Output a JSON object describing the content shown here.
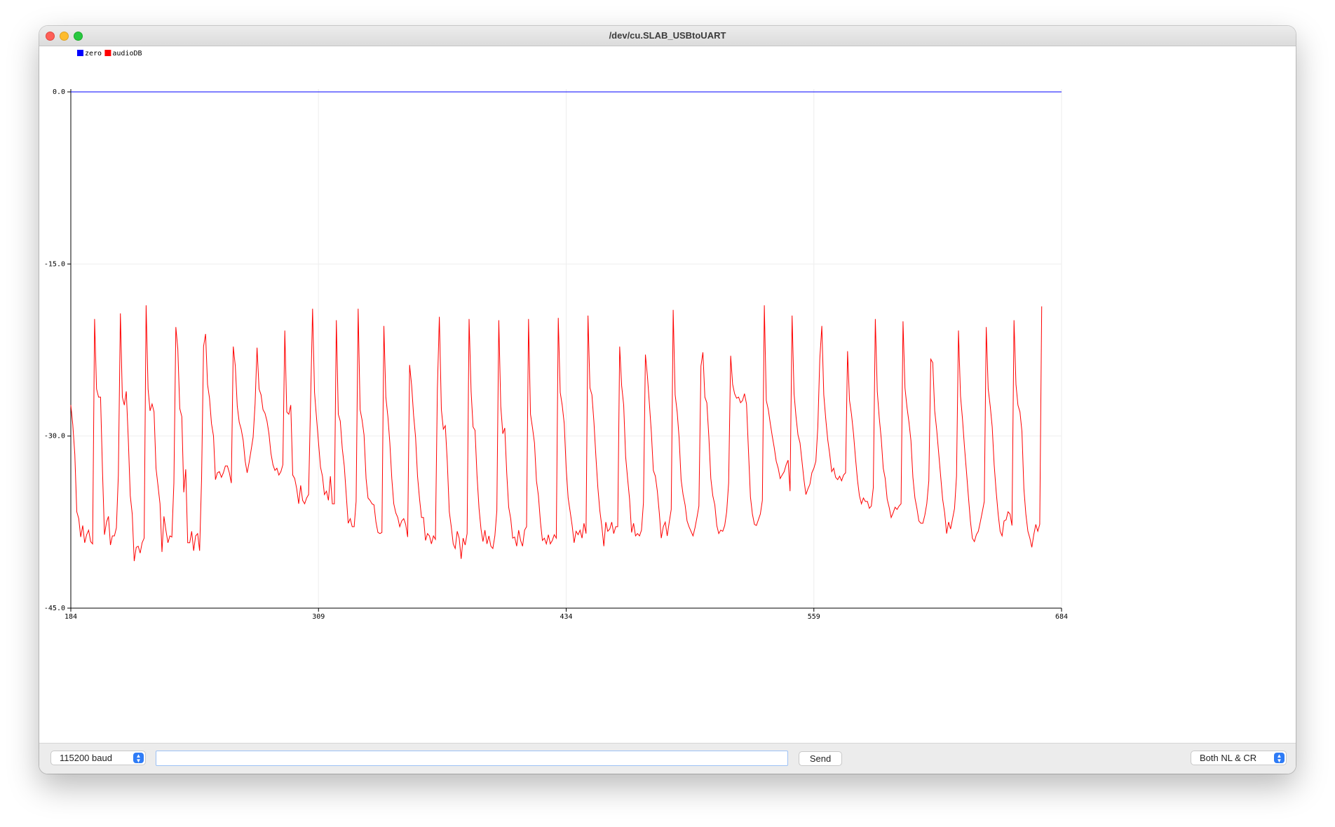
{
  "window": {
    "title": "/dev/cu.SLAB_USBtoUART"
  },
  "toolbar": {
    "baud_label": "115200 baud",
    "message_value": "",
    "send_label": "Send",
    "line_ending_label": "Both NL & CR"
  },
  "icons": {
    "stepper": "up-down-arrows-icon"
  },
  "colors": {
    "zero": "#0000ff",
    "audioDB": "#ff0000",
    "grid": "#eeeeee",
    "axis": "#000000"
  },
  "chart_data": {
    "type": "line",
    "xlim": [
      184,
      684
    ],
    "ylim": [
      -45,
      0
    ],
    "x_ticks": [
      184,
      309,
      434,
      559,
      684
    ],
    "y_ticks": [
      0,
      -15,
      -30,
      -45
    ],
    "x_tick_labels": [
      "184",
      "309",
      "434",
      "559",
      "684"
    ],
    "y_tick_labels": [
      "0.0",
      "-15.0",
      "-30.0",
      "-45.0"
    ],
    "grid": true,
    "legend_position": "top-left",
    "series": [
      {
        "name": "zero",
        "color": "#0000ff",
        "x_start": 184,
        "x_step": 1,
        "values": [
          0,
          0
        ]
      },
      {
        "name": "audioDB",
        "color": "#ff0000",
        "x_start": 184,
        "x_step": 1,
        "values": [
          -27.3,
          -29,
          -31.6,
          -36.6,
          -37.2,
          -38.8,
          -37.8,
          -39.3,
          -38.6,
          -38.2,
          -39.2,
          -39.4,
          -19.8,
          -25.9,
          -26.6,
          -26.6,
          -33.1,
          -38.6,
          -37.5,
          -37,
          -39.5,
          -38.7,
          -38.7,
          -38,
          -33.4,
          -19.3,
          -26.6,
          -27.3,
          -26.1,
          -30.3,
          -35.2,
          -36.8,
          -40.9,
          -39.7,
          -39.6,
          -40.2,
          -39.3,
          -38.9,
          -18.6,
          -25.9,
          -27.8,
          -27.2,
          -27.9,
          -32.8,
          -34.3,
          -35.9,
          -40.1,
          -37,
          -38.2,
          -39.3,
          -38.7,
          -38.8,
          -34.1,
          -20.5,
          -22.4,
          -27.6,
          -28.3,
          -34.9,
          -32.9,
          -39.3,
          -39.3,
          -38.3,
          -40,
          -38.7,
          -38.5,
          -40,
          -33.7,
          -22.2,
          -21.1,
          -25.5,
          -26.7,
          -28.9,
          -30,
          -33.8,
          -33.2,
          -33.1,
          -33.6,
          -33.2,
          -32.6,
          -32.6,
          -33.2,
          -34.1,
          -22.2,
          -23.9,
          -27.4,
          -28.8,
          -29.4,
          -30.4,
          -32.2,
          -33.2,
          -32.3,
          -31.2,
          -30.1,
          -27.2,
          -22.3,
          -25.9,
          -26.4,
          -27.7,
          -28,
          -28.7,
          -29.8,
          -31.5,
          -32.5,
          -33,
          -32.8,
          -33.4,
          -33.1,
          -32.5,
          -20.8,
          -27.9,
          -28.1,
          -27.3,
          -33.4,
          -33.7,
          -34.6,
          -35.9,
          -34.3,
          -35.6,
          -35.9,
          -35.4,
          -35.1,
          -27.2,
          -18.9,
          -26.2,
          -28.4,
          -30.6,
          -32.7,
          -33.5,
          -35.1,
          -34.8,
          -35.6,
          -33.5,
          -35.9,
          -35.9,
          -19.9,
          -28.1,
          -28.7,
          -31.1,
          -32.6,
          -35.1,
          -37.6,
          -37.2,
          -37.9,
          -37.9,
          -35.7,
          -18.9,
          -27.7,
          -28.6,
          -29.9,
          -33.7,
          -35.4,
          -35.6,
          -35.9,
          -36,
          -37.5,
          -38.4,
          -38.5,
          -38.4,
          -20.4,
          -26.6,
          -28.3,
          -30.6,
          -33.7,
          -35.9,
          -36.7,
          -37.1,
          -37.9,
          -37.4,
          -37.2,
          -37.7,
          -38.8,
          -23.8,
          -25.6,
          -28.2,
          -30.1,
          -33.5,
          -35.5,
          -37.1,
          -37.1,
          -39.1,
          -38.5,
          -38.7,
          -39.4,
          -38.7,
          -39,
          -25.9,
          -19.6,
          -27.7,
          -29.4,
          -29.1,
          -32.2,
          -36.6,
          -37.9,
          -39.4,
          -39.8,
          -38.3,
          -38.9,
          -40.7,
          -38.9,
          -39.5,
          -38.5,
          -19.8,
          -26.1,
          -29.2,
          -29.5,
          -33.4,
          -36.3,
          -38.1,
          -39.2,
          -38.2,
          -39.4,
          -38.7,
          -39.6,
          -39.8,
          -38.7,
          -36.5,
          -19.9,
          -27.4,
          -29.8,
          -29.3,
          -33.2,
          -36.2,
          -37.2,
          -38.9,
          -38.8,
          -39.6,
          -38.2,
          -39.1,
          -39.6,
          -38.2,
          -37.9,
          -19.8,
          -28.1,
          -29.3,
          -30.6,
          -33.9,
          -35.2,
          -37.5,
          -39.1,
          -38.9,
          -39.4,
          -38.6,
          -39.4,
          -39.1,
          -38.6,
          -38.9,
          -19.7,
          -26.2,
          -27.3,
          -28.9,
          -32.8,
          -35.4,
          -36.6,
          -37.8,
          -39.3,
          -38.3,
          -38.6,
          -38.2,
          -38.9,
          -37.6,
          -38.5,
          -19.5,
          -25.8,
          -26.4,
          -28.8,
          -31.8,
          -34.5,
          -36.5,
          -37.9,
          -39.6,
          -37.5,
          -38.3,
          -38.1,
          -37.5,
          -38.5,
          -37.9,
          -37.9,
          -22.2,
          -25.6,
          -27.3,
          -31.8,
          -33.7,
          -35.5,
          -38.4,
          -37.6,
          -38.7,
          -38.5,
          -38.7,
          -38.2,
          -35.8,
          -22.9,
          -24.8,
          -27.2,
          -29.7,
          -33,
          -33.5,
          -34.8,
          -36.7,
          -38.9,
          -37.9,
          -37.5,
          -38.7,
          -37.5,
          -36.4,
          -19,
          -26.4,
          -27.9,
          -30.2,
          -33.8,
          -35.1,
          -36,
          -37.4,
          -37.9,
          -38.3,
          -38.7,
          -38,
          -37.1,
          -36.1,
          -23.9,
          -22.7,
          -26.6,
          -27.1,
          -30.1,
          -33.7,
          -35.2,
          -36,
          -37.8,
          -38.5,
          -38.2,
          -38.3,
          -37.8,
          -36.6,
          -34.1,
          -23,
          -25.5,
          -26.3,
          -26.7,
          -26.6,
          -27.1,
          -26.9,
          -26.3,
          -27.2,
          -31.3,
          -35.3,
          -36.8,
          -37.7,
          -37.8,
          -37.3,
          -36.8,
          -35.6,
          -18.6,
          -26.9,
          -27.7,
          -28.9,
          -30,
          -31,
          -32.2,
          -32.8,
          -33.7,
          -33.4,
          -33.1,
          -32.5,
          -32.1,
          -34.8,
          -19.5,
          -26.3,
          -28.3,
          -29.9,
          -30.6,
          -32.2,
          -33.8,
          -35.1,
          -34.6,
          -34.2,
          -33.2,
          -32.8,
          -32.2,
          -29.2,
          -23.3,
          -20.4,
          -26.4,
          -28.5,
          -30.3,
          -31.6,
          -33.1,
          -32.8,
          -33.6,
          -33.8,
          -33.5,
          -33.9,
          -33.4,
          -33.2,
          -22.6,
          -26.9,
          -28.1,
          -29.8,
          -31.9,
          -33.8,
          -35.2,
          -35.9,
          -35.4,
          -35.7,
          -35.7,
          -36.3,
          -36.1,
          -34.5,
          -19.8,
          -26.1,
          -28.4,
          -30.2,
          -32.8,
          -33.7,
          -35.5,
          -36.2,
          -37.1,
          -36.7,
          -36.2,
          -36.4,
          -36.1,
          -35.9,
          -20,
          -25.8,
          -27.5,
          -28.8,
          -30.4,
          -33.6,
          -35.4,
          -36.3,
          -37.4,
          -37.6,
          -37.6,
          -36.9,
          -35.9,
          -33.9,
          -23.3,
          -23.6,
          -27.8,
          -29.5,
          -31.5,
          -33.5,
          -35.5,
          -36.7,
          -38.5,
          -37.5,
          -38.1,
          -37.2,
          -36.3,
          -33.5,
          -20.8,
          -26.5,
          -28.5,
          -30.9,
          -33.1,
          -35.3,
          -37.4,
          -38.9,
          -39.2,
          -38.6,
          -38.3,
          -37.5,
          -36.6,
          -35.7,
          -20.5,
          -25.9,
          -27.4,
          -29.2,
          -32.5,
          -34.8,
          -36.8,
          -38.3,
          -38.7,
          -37.4,
          -37.3,
          -36.6,
          -36.8,
          -37.8,
          -19.9,
          -25.5,
          -27.3,
          -27.9,
          -29.6,
          -34.6,
          -36.8,
          -38.3,
          -38.9,
          -39.7,
          -38.6,
          -37.7,
          -38.3,
          -37.7,
          -18.7
        ]
      }
    ]
  }
}
